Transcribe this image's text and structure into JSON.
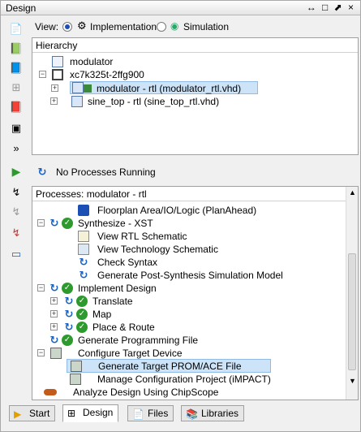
{
  "window": {
    "title": "Design",
    "controls": "↔ □ ⬈ ×"
  },
  "viewbar": {
    "label": "View:",
    "impl": "Implementation",
    "sim": "Simulation"
  },
  "hierarchy": {
    "header": "Hierarchy",
    "rows": [
      {
        "label": "modulator"
      },
      {
        "label": "xc7k325t-2ffg900"
      },
      {
        "label": "modulator - rtl (modulator_rtl.vhd)"
      },
      {
        "label": "sine_top - rtl (sine_top_rtl.vhd)"
      }
    ]
  },
  "status": {
    "text": "No Processes Running"
  },
  "processes": {
    "header": "Processes: modulator - rtl",
    "rows": [
      {
        "label": "Floorplan Area/IO/Logic (PlanAhead)"
      },
      {
        "label": "Synthesize - XST"
      },
      {
        "label": "View RTL Schematic"
      },
      {
        "label": "View Technology Schematic"
      },
      {
        "label": "Check Syntax"
      },
      {
        "label": "Generate Post-Synthesis Simulation Model"
      },
      {
        "label": "Implement Design"
      },
      {
        "label": "Translate"
      },
      {
        "label": "Map"
      },
      {
        "label": "Place & Route"
      },
      {
        "label": "Generate Programming File"
      },
      {
        "label": "Configure Target Device"
      },
      {
        "label": "Generate Target PROM/ACE File"
      },
      {
        "label": "Manage Configuration Project (iMPACT)"
      },
      {
        "label": "Analyze Design Using ChipScope"
      }
    ]
  },
  "tabs": [
    {
      "label": "Start"
    },
    {
      "label": "Design"
    },
    {
      "label": "Files"
    },
    {
      "label": "Libraries"
    }
  ]
}
